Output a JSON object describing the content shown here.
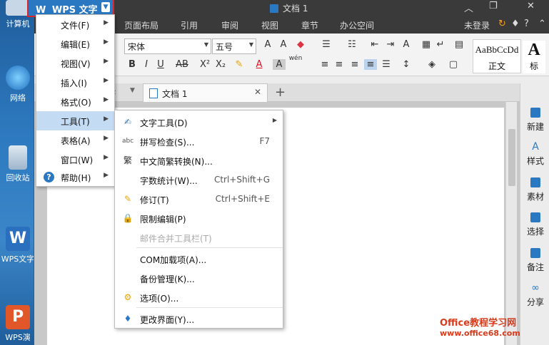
{
  "desktop": {
    "icons": [
      {
        "label": "计算机"
      },
      {
        "label": "网络"
      },
      {
        "label": "回收站"
      },
      {
        "label": "WPS文字"
      },
      {
        "label": "WPS演"
      }
    ]
  },
  "app": {
    "brand_label": "WPS 文字",
    "doc_title": "文档 1",
    "ribbon_tabs": [
      "页面布局",
      "引用",
      "审阅",
      "视图",
      "章节",
      "办公空间"
    ],
    "login_label": "未登录",
    "font_name": "宋体",
    "font_size": "五号",
    "style_sample": "AaBbCcDd",
    "style_label": "正文",
    "style2_sample": "A",
    "style2_label": "标",
    "doc_tab_label": "文档 1",
    "right_panel": [
      {
        "label": "新建"
      },
      {
        "label": "样式"
      },
      {
        "label": "素材"
      },
      {
        "label": "选择"
      },
      {
        "label": "备注"
      },
      {
        "label": "分享"
      }
    ]
  },
  "main_menu": {
    "items": [
      {
        "label": "文件(F)"
      },
      {
        "label": "编辑(E)"
      },
      {
        "label": "视图(V)"
      },
      {
        "label": "插入(I)"
      },
      {
        "label": "格式(O)"
      },
      {
        "label": "工具(T)"
      },
      {
        "label": "表格(A)"
      },
      {
        "label": "窗口(W)"
      },
      {
        "label": "帮助(H)"
      }
    ]
  },
  "tools_menu": {
    "items": [
      {
        "label": "文字工具(D)",
        "shortcut": ""
      },
      {
        "label": "拼写检查(S)...",
        "shortcut": "F7"
      },
      {
        "label": "中文简繁转换(N)...",
        "shortcut": ""
      },
      {
        "label": "字数统计(W)...",
        "shortcut": "Ctrl+Shift+G"
      },
      {
        "label": "修订(T)",
        "shortcut": "Ctrl+Shift+E"
      },
      {
        "label": "限制编辑(P)",
        "shortcut": ""
      },
      {
        "label": "邮件合并工具栏(T)",
        "shortcut": ""
      },
      {
        "label": "COM加载项(A)...",
        "shortcut": ""
      },
      {
        "label": "备份管理(K)...",
        "shortcut": ""
      },
      {
        "label": "选项(O)...",
        "shortcut": ""
      },
      {
        "label": "更改界面(Y)...",
        "shortcut": ""
      }
    ]
  },
  "watermark": {
    "title": "Office教程学习网",
    "url": "www.office68.com"
  },
  "colors": {
    "accent": "#2b78c2",
    "menu_highlight": "#c4dbf4",
    "brand_outline": "#d8262e"
  }
}
